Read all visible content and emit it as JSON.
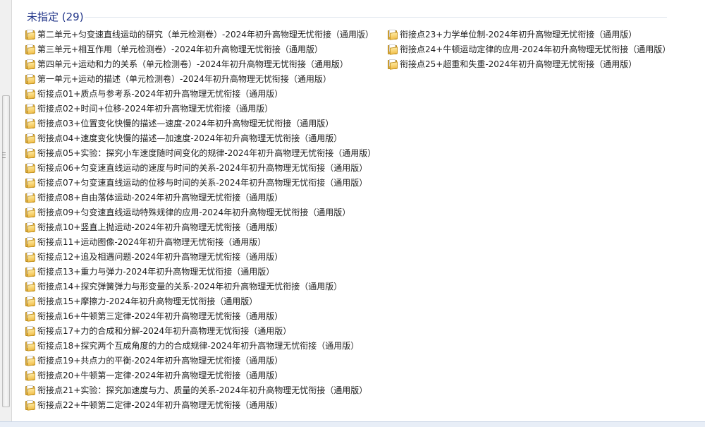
{
  "group": {
    "title": "未指定 (29)"
  },
  "files": [
    "第二单元+匀变速直线运动的研究（单元检测卷）-2024年初升高物理无忧衔接（通用版）",
    "第三单元+相互作用（单元检测卷）-2024年初升高物理无忧衔接（通用版）",
    "第四单元+运动和力的关系（单元检测卷）-2024年初升高物理无忧衔接（通用版）",
    "第一单元+运动的描述（单元检测卷）-2024年初升高物理无忧衔接（通用版）",
    "衔接点01+质点与参考系-2024年初升高物理无忧衔接（通用版）",
    "衔接点02+时间+位移-2024年初升高物理无忧衔接（通用版）",
    "衔接点03+位置变化快慢的描述—速度-2024年初升高物理无忧衔接（通用版）",
    "衔接点04+速度变化快慢的描述—加速度-2024年初升高物理无忧衔接（通用版）",
    "衔接点05+实验：探究小车速度随时间变化的规律-2024年初升高物理无忧衔接（通用版）",
    "衔接点06+匀变速直线运动的速度与时间的关系-2024年初升高物理无忧衔接（通用版）",
    "衔接点07+匀变速直线运动的位移与时间的关系-2024年初升高物理无忧衔接（通用版）",
    "衔接点08+自由落体运动-2024年初升高物理无忧衔接（通用版）",
    "衔接点09+匀变速直线运动特殊规律的应用-2024年初升高物理无忧衔接（通用版）",
    "衔接点10+竖直上抛运动-2024年初升高物理无忧衔接（通用版）",
    "衔接点11+运动图像-2024年初升高物理无忧衔接（通用版）",
    "衔接点12+追及相遇问题-2024年初升高物理无忧衔接（通用版）",
    "衔接点13+重力与弹力-2024年初升高物理无忧衔接（通用版）",
    "衔接点14+探究弹簧弹力与形变量的关系-2024年初升高物理无忧衔接（通用版）",
    "衔接点15+摩擦力-2024年初升高物理无忧衔接（通用版）",
    "衔接点16+牛顿第三定律-2024年初升高物理无忧衔接（通用版）",
    "衔接点17+力的合成和分解-2024年初升高物理无忧衔接（通用版）",
    "衔接点18+探究两个互成角度的力的合成规律-2024年初升高物理无忧衔接（通用版）",
    "衔接点19+共点力的平衡-2024年初升高物理无忧衔接（通用版）",
    "衔接点20+牛顿第一定律-2024年初升高物理无忧衔接（通用版）",
    "衔接点21+实验：探究加速度与力、质量的关系-2024年初升高物理无忧衔接（通用版）",
    "衔接点22+牛顿第二定律-2024年初升高物理无忧衔接（通用版）",
    "衔接点23+力学单位制-2024年初升高物理无忧衔接（通用版）",
    "衔接点24+牛顿运动定律的应用-2024年初升高物理无忧衔接（通用版）",
    "衔接点25+超重和失重-2024年初升高物理无忧衔接（通用版）"
  ]
}
